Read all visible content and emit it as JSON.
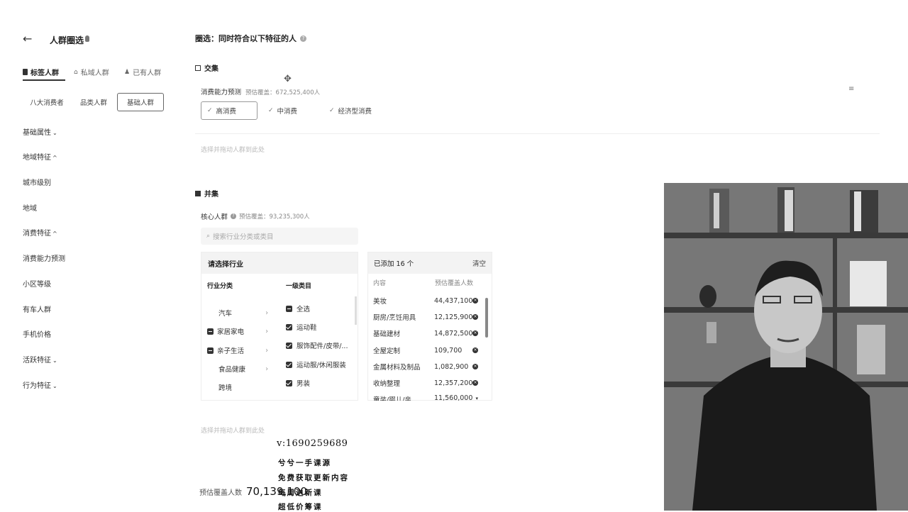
{
  "header": {
    "back_icon": "arrow-left-icon",
    "title": "人群圈选",
    "tip_icon": "bulb-icon"
  },
  "sidebar": {
    "tabs": [
      {
        "label": "标签人群",
        "icon": "tag-icon",
        "active": true
      },
      {
        "label": "私域人群",
        "icon": "store-icon",
        "active": false
      },
      {
        "label": "已有人群",
        "icon": "user-icon",
        "active": false
      }
    ],
    "pills": [
      {
        "label": "八大消费者",
        "active": false
      },
      {
        "label": "品类人群",
        "active": false
      },
      {
        "label": "基础人群",
        "active": true
      }
    ],
    "items": [
      {
        "label": "基础属性",
        "chevron": "⌄"
      },
      {
        "label": "地域特征",
        "chevron": "^"
      },
      {
        "label": "城市级别",
        "chevron": ""
      },
      {
        "label": "地域",
        "chevron": ""
      },
      {
        "label": "消费特征",
        "chevron": "^"
      },
      {
        "label": "消费能力预测",
        "chevron": ""
      },
      {
        "label": "小区等级",
        "chevron": ""
      },
      {
        "label": "有车人群",
        "chevron": ""
      },
      {
        "label": "手机价格",
        "chevron": ""
      },
      {
        "label": "活跃特征",
        "chevron": "⌄"
      },
      {
        "label": "行为特征",
        "chevron": "⌄"
      }
    ]
  },
  "main": {
    "heading": "圈选：同时符合以下特征的人",
    "intersection": {
      "title": "交集",
      "condition_label": "消费能力预测",
      "estimate": "预估覆盖：672,525,400人",
      "options": [
        {
          "label": "高消费",
          "active": true
        },
        {
          "label": "中消费",
          "active": false
        },
        {
          "label": "经济型消费",
          "active": false
        }
      ],
      "drag_hint": "选择并拖动人群到此处"
    },
    "union": {
      "title": "并集",
      "condition_label": "核心人群",
      "estimate": "预估覆盖：93,235,300人",
      "search_placeholder": "搜索行业分类或类目"
    },
    "industry_panel": {
      "title": "请选择行业",
      "col1_header": "行业分类",
      "col2_header": "一级类目",
      "industries": [
        {
          "label": "汽车",
          "state": "none"
        },
        {
          "label": "家居家电",
          "state": "indeterminate"
        },
        {
          "label": "亲子生活",
          "state": "indeterminate"
        },
        {
          "label": "食品健康",
          "state": "none"
        },
        {
          "label": "跨境",
          "state": "none"
        }
      ],
      "categories": [
        {
          "label": "全选",
          "state": "indeterminate"
        },
        {
          "label": "运动鞋",
          "state": "checked"
        },
        {
          "label": "服饰配件/皮带/...",
          "state": "checked"
        },
        {
          "label": "运动服/休闲服装",
          "state": "checked"
        },
        {
          "label": "男装",
          "state": "checked"
        }
      ]
    },
    "added_panel": {
      "title": "已添加 16 个",
      "clear": "清空",
      "col_content": "内容",
      "col_estimate": "预估覆盖人数",
      "rows": [
        {
          "name": "美妆",
          "count": "44,437,100"
        },
        {
          "name": "厨房/烹饪用具",
          "count": "12,125,900"
        },
        {
          "name": "基础建材",
          "count": "14,872,500"
        },
        {
          "name": "全屋定制",
          "count": "109,700"
        },
        {
          "name": "金属材料及制品",
          "count": "1,082,900"
        },
        {
          "name": "收纳整理",
          "count": "12,357,200"
        },
        {
          "name": "童装/婴儿/亲...",
          "count": "11,560,000"
        }
      ]
    },
    "drag_hint2": "选择并拖动人群到此处",
    "footer": {
      "label": "预估覆盖人数",
      "value": "70,139,100"
    }
  },
  "overlay": {
    "contact": "v:1690259689",
    "lines": [
      "兮兮一手课源",
      "免费获取更新内容",
      "每周送新课",
      "超低价筹课"
    ]
  }
}
